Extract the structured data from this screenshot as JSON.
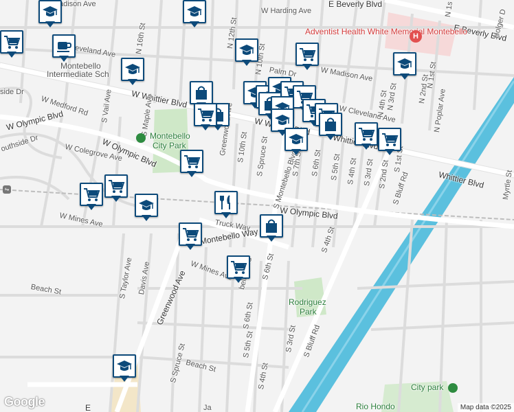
{
  "map": {
    "streets": {
      "madison_ave_nw": "adison Ave",
      "w_harding_ave": "W Harding Ave",
      "e_beverly_blvd_top": "E Beverly Blvd",
      "e_beverly_blvd": "E Beverly Blvd",
      "cleveland_ave_w": "Cleveland Ave",
      "n_16th_st": "N 16th St",
      "n_12th_st": "N 12th St",
      "n_10th_st": "N 10th St",
      "palm_dr": "Palm Dr",
      "w_madison_ave": "W Madison Ave",
      "w_whittier_blvd_left": "W Whittier Blvd",
      "w_whittier_blvd_mid": "W Whittier Blvd",
      "whittier_blvd_right": "Whittier Blvd",
      "w_cleveland_ave": "W Cleveland Ave",
      "n_4th_st": "N 4th St",
      "n_3rd_st": "N 3rd St",
      "n_2nd_st": "N 2nd St",
      "n_1st_st": "N 1st St",
      "n_poplar_ave": "N Poplar Ave",
      "holger_dr": "Holger D",
      "n_1st": "N 1s",
      "w_medford_rd": "W Medford Rd",
      "s_vail_ave": "S Vail Ave",
      "s_maple_ave": "S Maple Ave",
      "w_olympic_blvd_left": "W Olympic Blvd",
      "southside_dr": "outhside Dr",
      "parkside_dr": "side Dr",
      "w_colegrove_ave": "W Colegrove Ave",
      "w_olympic_blvd_mid": "W Olympic Blvd",
      "greenwood_ave_north": "Greenwood Ave",
      "s_10th_st": "S 10th St",
      "s_spruce_st": "S Spruce St",
      "s_montebello_blvd": "S Montebello Blvd",
      "s_7th_st": "S 7th St",
      "s_6th_st": "S 6th St",
      "s_5th_st": "S 5th St",
      "s_4th_st": "S 4th St",
      "s_3rd_st": "S 3rd St",
      "s_2nd_st": "S 2nd St",
      "s_1st_st": "S 1st St",
      "s_bluff_rd": "S Bluff Rd",
      "whittier_blvd_far_right": "Whittier Blvd",
      "myrtle_st": "Myrtle St",
      "w_olympic_blvd_right": "W Olympic Blvd",
      "w_mines_ave_left": "W Mines Ave",
      "truck_way": "Truck Way",
      "montebello_way": "Montebello Way",
      "s_4th_st_2": "S 4th St",
      "w_mines_ave": "W Mines Ave",
      "montebello_blvd_s": "bello Blvd",
      "s_6th_st_2": "S 6th St",
      "s_taylor_ave": "S Taylor Ave",
      "davis_ave": "Davis Ave",
      "greenwood_ave_south": "Greenwood Ave",
      "beach_st": "Beach St",
      "s_6th_st_3": "S 6th St",
      "s_5th_st_2": "S 5th St",
      "s_3rd_st_2": "S 3rd St",
      "s_bluff_rd_2": "S Bluff Rd",
      "beach_st_2": "Beach St",
      "s_spruce_st_2": "S Spruce St",
      "s_4th_st_3": "S 4th St",
      "ja_partial": "Ja",
      "e_partial": "E"
    },
    "pois": {
      "hospital": "Adventist Health White Memorial Montebello",
      "school": "Montebello Intermediate School",
      "school_trunc": "Montebello\nIntermediate Sch",
      "park": "Montebello City Park",
      "park_line1": "Montebello",
      "park_line2": "City Park",
      "rodriguez_line1": "Rodriguez",
      "rodriguez_line2": "Park",
      "city_park": "City park",
      "rio_hondo": "Rio Hondo"
    },
    "icon_names": [
      "school-icon",
      "shopping-cart-icon",
      "coffee-icon",
      "shopping-bag-icon",
      "restaurant-icon"
    ],
    "colors": {
      "marker_border": "#0d4a7a",
      "river": "#5bc0de",
      "park": "#c8e6c0",
      "hospital_area": "#f6d7d7",
      "major_road": "#ffffff"
    },
    "attribution": {
      "logo": "Google",
      "data": "Map data ©2025"
    }
  }
}
